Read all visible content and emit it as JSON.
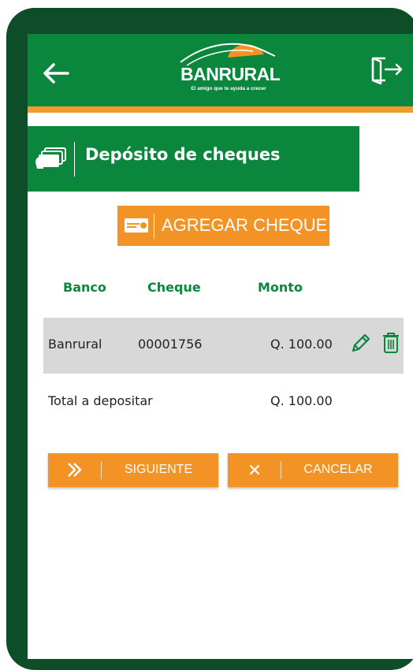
{
  "header": {
    "logo_name": "BANRURAL",
    "logo_tagline": "El amigo que te ayuda a crecer",
    "back_icon": "arrow-left-icon",
    "exit_icon": "logout-icon",
    "colors": {
      "primary": "#0a873c",
      "accent": "#f29a2e"
    }
  },
  "section": {
    "title": "Depósito de cheques",
    "icon": "cheque-icon"
  },
  "add_button": {
    "label": "AGREGAR CHEQUE",
    "icon": "cheque-card-icon"
  },
  "table": {
    "headers": {
      "bank": "Banco",
      "cheque": "Cheque",
      "amount": "Monto"
    },
    "rows": [
      {
        "bank": "Banrural",
        "cheque": "00001756",
        "amount": "Q. 100.00"
      }
    ]
  },
  "total": {
    "label": "Total a depositar",
    "value": "Q. 100.00"
  },
  "actions": {
    "next_label": "SIGUIENTE",
    "next_icon": "double-chevron-right-icon",
    "cancel_label": "CANCELAR",
    "cancel_icon": "close-icon"
  }
}
